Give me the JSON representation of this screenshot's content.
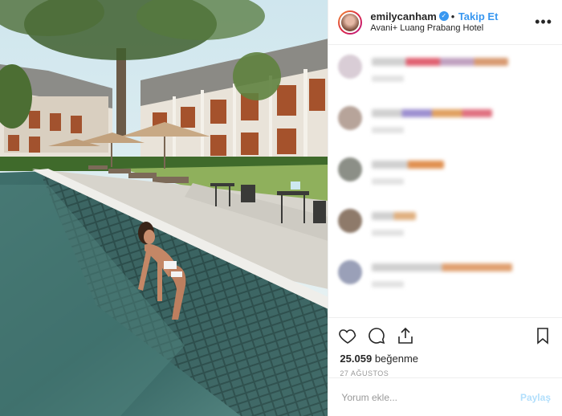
{
  "header": {
    "username": "emilycanham",
    "separator": "•",
    "follow_label": "Takip Et",
    "location": "Avani+ Luang Prabang Hotel",
    "more_icon": "more-horizontal-icon"
  },
  "comments": [
    {
      "avatar_color": "#d9cdd6",
      "line_colors": [
        "#d0d0d0",
        "#e06070",
        "#c0a0c0",
        "#d89a70"
      ]
    },
    {
      "avatar_color": "#b7a49a",
      "line_colors": [
        "#d0d0d0",
        "#9d8fd0",
        "#e0a060",
        "#e07080"
      ]
    },
    {
      "avatar_color": "#8c8f87",
      "line_colors": [
        "#d0d0d0",
        "#e09050"
      ]
    },
    {
      "avatar_color": "#8e7a6a",
      "line_colors": [
        "#d0d0d0",
        "#e0b080"
      ]
    },
    {
      "avatar_color": "#9aa0b8",
      "line_colors": [
        "#d0d0d0",
        "#e0a070"
      ]
    }
  ],
  "actions": {
    "like_icon": "heart-icon",
    "comment_icon": "comment-icon",
    "share_icon": "share-icon",
    "save_icon": "bookmark-icon"
  },
  "likes": {
    "count": "25.059",
    "label": "beğenme"
  },
  "date": "27 AĞUSTOS",
  "add_comment": {
    "placeholder": "Yorum ekle...",
    "post_label": "Paylaş"
  },
  "colors": {
    "accent": "#3897f0",
    "post_disabled": "#b2dffc"
  }
}
